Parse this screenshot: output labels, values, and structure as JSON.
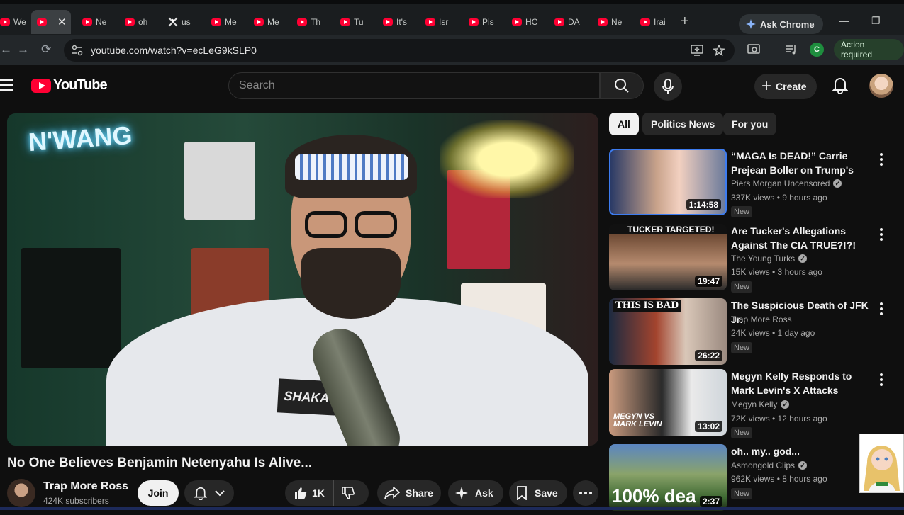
{
  "browser": {
    "tabs": [
      {
        "label": "We",
        "icon": "youtube-icon"
      },
      {
        "label": "",
        "icon": "youtube-icon",
        "active": true
      },
      {
        "label": "Ne",
        "icon": "youtube-icon"
      },
      {
        "label": "oh",
        "icon": "youtube-icon"
      },
      {
        "label": "us",
        "icon": "x-icon"
      },
      {
        "label": "Me",
        "icon": "youtube-icon"
      },
      {
        "label": "Me",
        "icon": "youtube-icon"
      },
      {
        "label": "Th",
        "icon": "youtube-icon"
      },
      {
        "label": "Tu",
        "icon": "youtube-icon"
      },
      {
        "label": "It's",
        "icon": "youtube-icon"
      },
      {
        "label": "Isr",
        "icon": "youtube-icon"
      },
      {
        "label": "Pis",
        "icon": "youtube-icon"
      },
      {
        "label": "HC",
        "icon": "youtube-icon"
      },
      {
        "label": "DA",
        "icon": "youtube-icon"
      },
      {
        "label": "Ne",
        "icon": "youtube-icon"
      },
      {
        "label": "Irai",
        "icon": "youtube-icon"
      }
    ],
    "ask_chrome": "Ask Chrome",
    "url": "youtube.com/watch?v=ecLeG9kSLP0",
    "profile_initial": "C",
    "action_required": "Action required"
  },
  "youtube": {
    "logo_text": "YouTube",
    "search_placeholder": "Search",
    "create_label": "Create",
    "brand_color": "#ff0033"
  },
  "video": {
    "title": "No One Believes Benjamin Netenyahu Is Alive...",
    "channel": "Trap More Ross",
    "subscribers": "424K subscribers",
    "join_label": "Join",
    "likes": "1K",
    "share_label": "Share",
    "ask_label": "Ask",
    "save_label": "Save",
    "player_shirt_text": "SHAKA WEAR",
    "player_neon_text": "N'WANG"
  },
  "chips": [
    "All",
    "Politics News",
    "For you"
  ],
  "recommendations": [
    {
      "title": "“MAGA Is DEAD!” Carrie Prejean Boller on Trump's Iran War | ...",
      "channel": "Piers Morgan Uncensored",
      "verified": true,
      "views": "337K views • 9 hours ago",
      "badge": "New",
      "duration": "1:14:58",
      "thumb_text": ""
    },
    {
      "title": "Are Tucker's Allegations Against The CIA TRUE?!?!",
      "channel": "The Young Turks",
      "verified": true,
      "views": "15K views • 3 hours ago",
      "badge": "New",
      "duration": "19:47",
      "thumb_text": "TUCKER TARGETED!"
    },
    {
      "title": "The Suspicious Death of JFK Jr.",
      "channel": "Trap More Ross",
      "verified": false,
      "views": "24K views • 1 day ago",
      "badge": "New",
      "duration": "26:22",
      "thumb_text": "THIS IS BAD"
    },
    {
      "title": "Megyn Kelly Responds to Mark Levin's X Attacks Against Her ...",
      "channel": "Megyn Kelly",
      "verified": true,
      "views": "72K views • 12 hours ago",
      "badge": "New",
      "duration": "13:02",
      "thumb_text": "MEGYN VS MARK LEVIN"
    },
    {
      "title": "oh.. my.. god...",
      "channel": "Asmongold Clips",
      "verified": true,
      "views": "962K views • 8 hours ago",
      "badge": "New",
      "duration": "2:37",
      "thumb_text": "100% dea"
    }
  ]
}
